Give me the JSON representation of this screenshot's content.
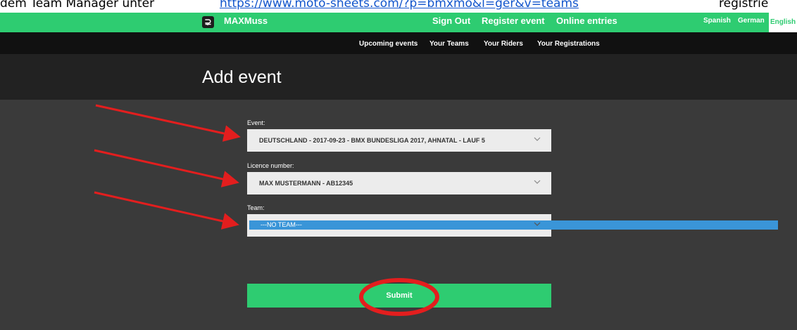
{
  "doc_caption": {
    "lead": "dem Team Manager unter",
    "link": "https://www.moto-sheets.com/?p=bmxmo&l=ger&v=teams",
    "tail": "registrie"
  },
  "topbar": {
    "logo_glyph": "⊋",
    "brand": "MAXMuss",
    "nav": [
      "Sign Out",
      "Register event",
      "Online entries"
    ],
    "languages": [
      "Spanish",
      "German"
    ],
    "active_language": "English"
  },
  "subnav": [
    "Upcoming events",
    "Your Teams",
    "Your Riders",
    "Your Registrations"
  ],
  "page": {
    "title": "Add event"
  },
  "form": {
    "event_label": "Event:",
    "event_value": "DEUTSCHLAND - 2017-09-23 - BMX BUNDESLIGA 2017, AHNATAL - LAUF 5",
    "licence_label": "Licence number:",
    "licence_value": "MAX MUSTERMANN - AB12345",
    "team_label": "Team:",
    "team_value": "---NO TEAM---",
    "submit_label": "Submit"
  },
  "colors": {
    "accent": "#2ecc71",
    "annotation": "#e31e1e",
    "selection": "#3a95d8"
  },
  "icons": [
    "logo-icon",
    "chevron-down-icon"
  ]
}
